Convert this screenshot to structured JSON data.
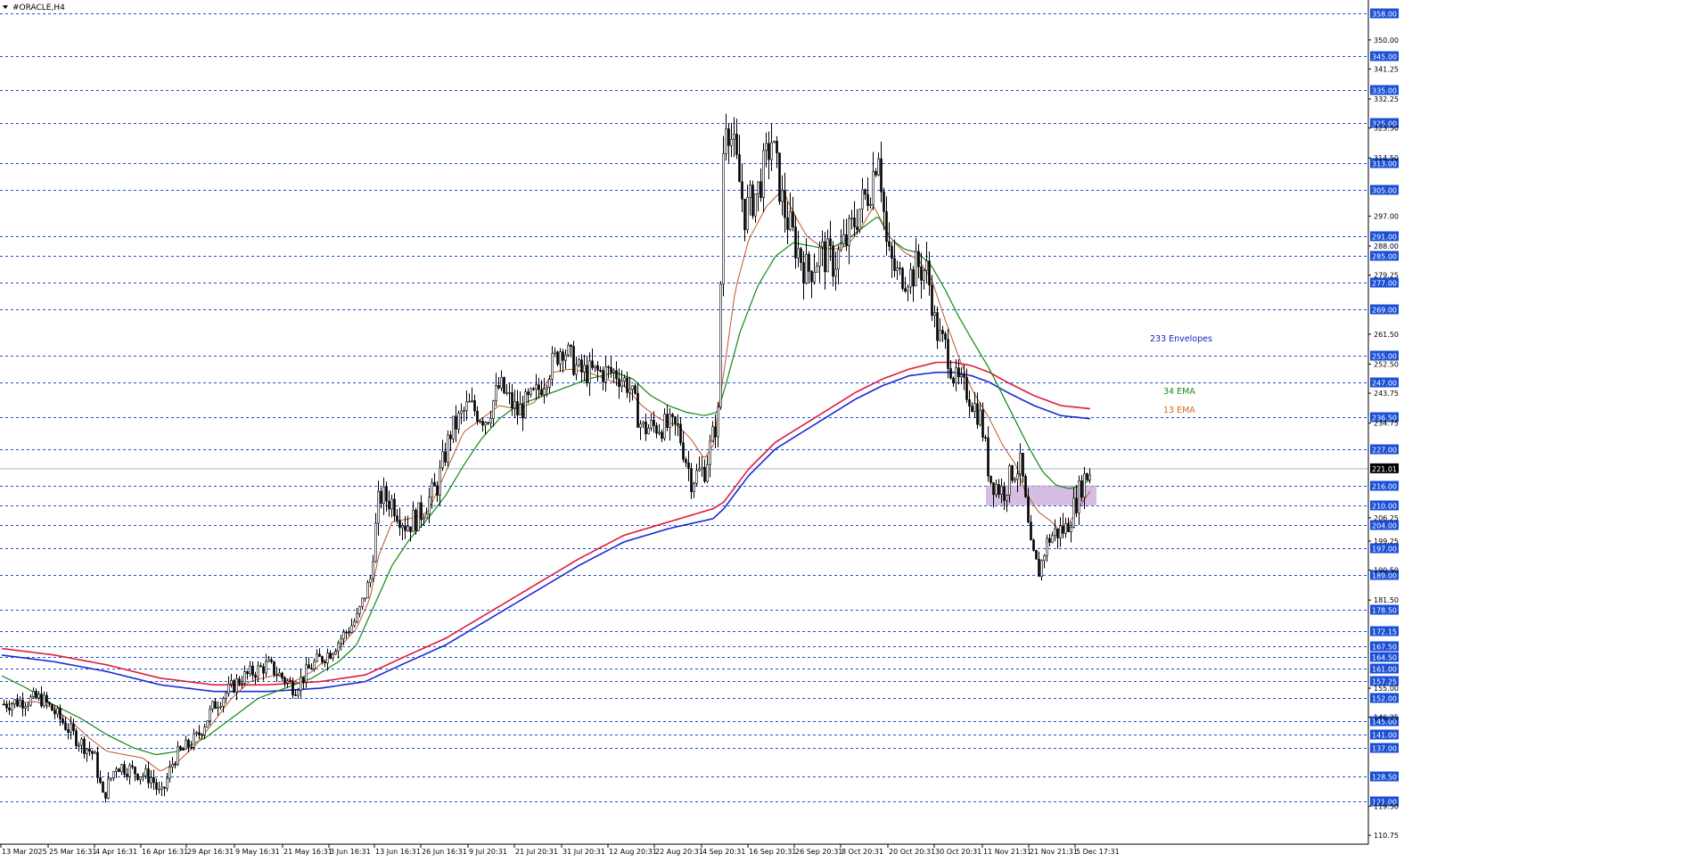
{
  "chart_data": {
    "type": "candlestick",
    "symbol_label": "#ORACLE,H4",
    "ylim": [
      110.75,
      358.0
    ],
    "price_scale_labels": [
      "350.00",
      "341.25",
      "332.25",
      "323.50",
      "314.50",
      "297.00",
      "288.00",
      "279.25",
      "261.50",
      "252.50",
      "243.75",
      "234.75",
      "206.25",
      "199.25",
      "190.50",
      "181.50",
      "155.00",
      "146.25",
      "119.50",
      "110.75"
    ],
    "level_lines": [
      {
        "price": 358.0,
        "label": "358.00"
      },
      {
        "price": 345.0,
        "label": "345.00"
      },
      {
        "price": 335.0,
        "label": "335.00"
      },
      {
        "price": 325.0,
        "label": "325.00"
      },
      {
        "price": 313.0,
        "label": "313.00"
      },
      {
        "price": 305.0,
        "label": "305.00"
      },
      {
        "price": 291.0,
        "label": "291.00"
      },
      {
        "price": 285.0,
        "label": "285.00"
      },
      {
        "price": 277.0,
        "label": "277.00"
      },
      {
        "price": 269.0,
        "label": "269.00"
      },
      {
        "price": 255.0,
        "label": "255.00"
      },
      {
        "price": 247.0,
        "label": "247.00"
      },
      {
        "price": 236.5,
        "label": "236.50"
      },
      {
        "price": 227.0,
        "label": "227.00"
      },
      {
        "price": 216.0,
        "label": "216.00"
      },
      {
        "price": 210.0,
        "label": "210.00"
      },
      {
        "price": 204.0,
        "label": "204.00"
      },
      {
        "price": 197.0,
        "label": "197.00"
      },
      {
        "price": 189.0,
        "label": "189.00"
      },
      {
        "price": 178.5,
        "label": "178.50"
      },
      {
        "price": 172.15,
        "label": "172.15"
      },
      {
        "price": 167.5,
        "label": "167.50"
      },
      {
        "price": 164.5,
        "label": "164.50"
      },
      {
        "price": 161.0,
        "label": "161.00"
      },
      {
        "price": 157.25,
        "label": "157.25"
      },
      {
        "price": 152.0,
        "label": "152.00"
      },
      {
        "price": 145.0,
        "label": "145.00"
      },
      {
        "price": 141.0,
        "label": "141.00"
      },
      {
        "price": 137.0,
        "label": "137.00"
      },
      {
        "price": 128.5,
        "label": "128.50"
      },
      {
        "price": 121.0,
        "label": "121.00"
      }
    ],
    "current_price": {
      "price": 221.01,
      "label": "221.01"
    },
    "x_labels": [
      "13 Mar 2025",
      "25 Mar 16:31",
      "4 Apr 16:31",
      "16 Apr 16:31",
      "29 Apr 16:31",
      "9 May 16:31",
      "21 May 16:31",
      "3 Jun 16:31",
      "13 Jun 16:31",
      "26 Jun 16:31",
      "9 Jul 20:31",
      "21 Jul 20:31",
      "31 Jul 20:31",
      "12 Aug 20:31",
      "22 Aug 20:31",
      "4 Sep 20:31",
      "16 Sep 20:31",
      "26 Sep 20:31",
      "8 Oct 20:31",
      "20 Oct 20:31",
      "30 Oct 20:31",
      "11 Nov 21:31",
      "21 Nov 21:31",
      "5 Dec 17:31"
    ],
    "annotations": [
      {
        "text": "233 Envelopes",
        "color": "#1a1ac8"
      },
      {
        "text": "34 EMA",
        "color": "#1f8c1f"
      },
      {
        "text": "13 EMA",
        "color": "#d2691e"
      }
    ],
    "zone": {
      "from": 210.0,
      "to": 216.0,
      "color": "#c8a8d8"
    },
    "colors": {
      "candles": "#000000",
      "grid": "#1a4fd6",
      "ema13": "#c0562a",
      "ema34": "#118811",
      "env_upper": "#e01a3c",
      "env_lower": "#1a2ad6",
      "current_line": "#a9b4c2"
    },
    "path_anchors": [
      [
        0,
        150
      ],
      [
        20,
        151
      ],
      [
        45,
        152
      ],
      [
        60,
        148
      ],
      [
        85,
        140
      ],
      [
        105,
        135
      ],
      [
        115,
        122
      ],
      [
        130,
        132
      ],
      [
        150,
        130
      ],
      [
        170,
        128
      ],
      [
        180,
        122
      ],
      [
        195,
        134
      ],
      [
        220,
        140
      ],
      [
        240,
        150
      ],
      [
        270,
        158
      ],
      [
        300,
        162
      ],
      [
        330,
        155
      ],
      [
        350,
        162
      ],
      [
        370,
        166
      ],
      [
        400,
        176
      ],
      [
        415,
        188
      ],
      [
        425,
        213
      ],
      [
        440,
        211
      ],
      [
        455,
        204
      ],
      [
        470,
        207
      ],
      [
        490,
        216
      ],
      [
        505,
        232
      ],
      [
        525,
        240
      ],
      [
        545,
        236
      ],
      [
        560,
        246
      ],
      [
        580,
        238
      ],
      [
        600,
        243
      ],
      [
        630,
        258
      ],
      [
        650,
        250
      ],
      [
        670,
        250
      ],
      [
        690,
        250
      ],
      [
        705,
        246
      ],
      [
        720,
        233
      ],
      [
        740,
        234
      ],
      [
        760,
        233
      ],
      [
        775,
        218
      ],
      [
        790,
        221
      ],
      [
        805,
        237
      ],
      [
        812,
        330
      ],
      [
        822,
        318
      ],
      [
        835,
        298
      ],
      [
        850,
        305
      ],
      [
        865,
        320
      ],
      [
        878,
        300
      ],
      [
        890,
        290
      ],
      [
        905,
        280
      ],
      [
        920,
        286
      ],
      [
        935,
        283
      ],
      [
        950,
        290
      ],
      [
        965,
        300
      ],
      [
        975,
        305
      ],
      [
        985,
        318
      ],
      [
        995,
        285
      ],
      [
        1005,
        280
      ],
      [
        1015,
        278
      ],
      [
        1030,
        282
      ],
      [
        1040,
        280
      ],
      [
        1050,
        262
      ],
      [
        1060,
        258
      ],
      [
        1070,
        248
      ],
      [
        1085,
        244
      ],
      [
        1100,
        236
      ],
      [
        1110,
        218
      ],
      [
        1125,
        214
      ],
      [
        1135,
        220
      ],
      [
        1145,
        222
      ],
      [
        1155,
        198
      ],
      [
        1165,
        190
      ],
      [
        1175,
        200
      ],
      [
        1185,
        202
      ],
      [
        1195,
        203
      ],
      [
        1205,
        210
      ],
      [
        1215,
        218
      ],
      [
        1225,
        221
      ]
    ],
    "ema13_anchors": [
      [
        0,
        150
      ],
      [
        40,
        151
      ],
      [
        60,
        149
      ],
      [
        80,
        145
      ],
      [
        100,
        140
      ],
      [
        120,
        136
      ],
      [
        140,
        135
      ],
      [
        160,
        134
      ],
      [
        180,
        130
      ],
      [
        200,
        133
      ],
      [
        220,
        138
      ],
      [
        240,
        145
      ],
      [
        260,
        152
      ],
      [
        280,
        157
      ],
      [
        310,
        159
      ],
      [
        330,
        157
      ],
      [
        350,
        160
      ],
      [
        380,
        167
      ],
      [
        400,
        173
      ],
      [
        415,
        182
      ],
      [
        425,
        195
      ],
      [
        440,
        205
      ],
      [
        460,
        206
      ],
      [
        480,
        208
      ],
      [
        500,
        220
      ],
      [
        520,
        232
      ],
      [
        540,
        236
      ],
      [
        560,
        240
      ],
      [
        580,
        239
      ],
      [
        600,
        241
      ],
      [
        620,
        250
      ],
      [
        640,
        251
      ],
      [
        660,
        250
      ],
      [
        680,
        248
      ],
      [
        700,
        246
      ],
      [
        720,
        240
      ],
      [
        740,
        236
      ],
      [
        760,
        234
      ],
      [
        775,
        230
      ],
      [
        790,
        224
      ],
      [
        800,
        228
      ],
      [
        812,
        250
      ],
      [
        825,
        275
      ],
      [
        840,
        290
      ],
      [
        860,
        300
      ],
      [
        878,
        305
      ],
      [
        890,
        298
      ],
      [
        905,
        291
      ],
      [
        920,
        288
      ],
      [
        935,
        287
      ],
      [
        950,
        288
      ],
      [
        965,
        293
      ],
      [
        980,
        300
      ],
      [
        990,
        295
      ],
      [
        1000,
        290
      ],
      [
        1015,
        286
      ],
      [
        1030,
        284
      ],
      [
        1045,
        278
      ],
      [
        1060,
        266
      ],
      [
        1075,
        255
      ],
      [
        1090,
        245
      ],
      [
        1110,
        236
      ],
      [
        1125,
        228
      ],
      [
        1140,
        222
      ],
      [
        1150,
        214
      ],
      [
        1165,
        208
      ],
      [
        1180,
        205
      ],
      [
        1190,
        202
      ],
      [
        1200,
        205
      ],
      [
        1212,
        210
      ],
      [
        1225,
        215
      ]
    ],
    "ema34_anchors": [
      [
        0,
        159
      ],
      [
        30,
        155
      ],
      [
        60,
        150
      ],
      [
        90,
        146
      ],
      [
        120,
        141
      ],
      [
        150,
        137
      ],
      [
        175,
        135
      ],
      [
        200,
        136
      ],
      [
        230,
        140
      ],
      [
        260,
        146
      ],
      [
        290,
        152
      ],
      [
        320,
        155
      ],
      [
        350,
        158
      ],
      [
        380,
        163
      ],
      [
        400,
        168
      ],
      [
        420,
        180
      ],
      [
        440,
        192
      ],
      [
        460,
        200
      ],
      [
        480,
        206
      ],
      [
        500,
        213
      ],
      [
        520,
        222
      ],
      [
        540,
        230
      ],
      [
        560,
        236
      ],
      [
        580,
        240
      ],
      [
        610,
        243
      ],
      [
        640,
        246
      ],
      [
        660,
        248
      ],
      [
        690,
        250
      ],
      [
        710,
        248
      ],
      [
        730,
        243
      ],
      [
        750,
        240
      ],
      [
        770,
        238
      ],
      [
        790,
        237
      ],
      [
        805,
        238
      ],
      [
        815,
        247
      ],
      [
        830,
        262
      ],
      [
        850,
        276
      ],
      [
        870,
        285
      ],
      [
        890,
        289
      ],
      [
        910,
        288
      ],
      [
        930,
        287
      ],
      [
        950,
        290
      ],
      [
        970,
        294
      ],
      [
        985,
        297
      ],
      [
        1000,
        290
      ],
      [
        1015,
        287
      ],
      [
        1030,
        286
      ],
      [
        1045,
        282
      ],
      [
        1060,
        275
      ],
      [
        1075,
        267
      ],
      [
        1090,
        260
      ],
      [
        1110,
        251
      ],
      [
        1125,
        243
      ],
      [
        1140,
        235
      ],
      [
        1155,
        227
      ],
      [
        1170,
        220
      ],
      [
        1185,
        216
      ],
      [
        1200,
        215
      ],
      [
        1212,
        216
      ],
      [
        1225,
        218
      ]
    ],
    "env_upper_anchors": [
      [
        0,
        167
      ],
      [
        60,
        165
      ],
      [
        120,
        162
      ],
      [
        180,
        158
      ],
      [
        240,
        156
      ],
      [
        300,
        156
      ],
      [
        360,
        157
      ],
      [
        410,
        159
      ],
      [
        450,
        164
      ],
      [
        500,
        170
      ],
      [
        550,
        178
      ],
      [
        600,
        186
      ],
      [
        650,
        194
      ],
      [
        700,
        201
      ],
      [
        750,
        205
      ],
      [
        800,
        209
      ],
      [
        812,
        211
      ],
      [
        840,
        221
      ],
      [
        870,
        229
      ],
      [
        900,
        234
      ],
      [
        930,
        239
      ],
      [
        960,
        244
      ],
      [
        990,
        248
      ],
      [
        1020,
        251
      ],
      [
        1050,
        253
      ],
      [
        1070,
        253
      ],
      [
        1090,
        252
      ],
      [
        1110,
        250
      ],
      [
        1130,
        247
      ],
      [
        1160,
        243
      ],
      [
        1190,
        240
      ],
      [
        1225,
        239
      ]
    ],
    "env_lower_anchors": [
      [
        0,
        165
      ],
      [
        60,
        163
      ],
      [
        120,
        160
      ],
      [
        180,
        156
      ],
      [
        240,
        154
      ],
      [
        300,
        154
      ],
      [
        360,
        155
      ],
      [
        410,
        157
      ],
      [
        450,
        162
      ],
      [
        500,
        168
      ],
      [
        550,
        176
      ],
      [
        600,
        184
      ],
      [
        650,
        192
      ],
      [
        700,
        199
      ],
      [
        750,
        203
      ],
      [
        800,
        206
      ],
      [
        812,
        209
      ],
      [
        840,
        219
      ],
      [
        870,
        227
      ],
      [
        900,
        232
      ],
      [
        930,
        237
      ],
      [
        960,
        242
      ],
      [
        990,
        246
      ],
      [
        1020,
        249
      ],
      [
        1050,
        250
      ],
      [
        1070,
        250
      ],
      [
        1090,
        249
      ],
      [
        1110,
        247
      ],
      [
        1130,
        244
      ],
      [
        1160,
        240
      ],
      [
        1190,
        237
      ],
      [
        1225,
        236
      ]
    ]
  }
}
